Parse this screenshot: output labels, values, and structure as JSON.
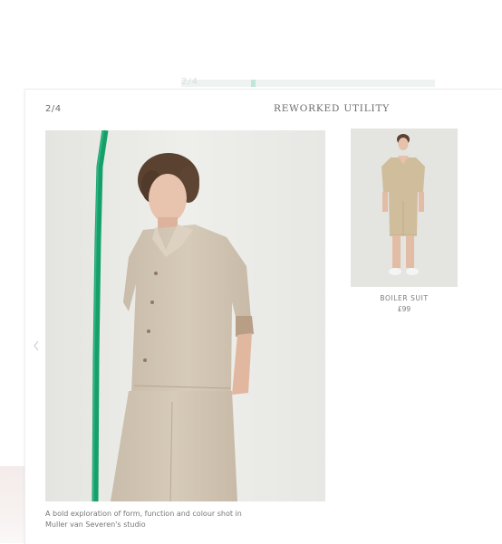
{
  "background_page": {
    "counter": "2/4"
  },
  "gallery": {
    "counter": "2/4",
    "title": "REWORKED UTILITY",
    "caption": "A bold exploration of form, function and colour shot in Muller van Severen's studio",
    "prev_icon": "chevron-left-icon"
  },
  "product": {
    "name": "BOILER SUIT",
    "price": "£99"
  },
  "colors": {
    "accent_green": "#16a46c",
    "garment_beige": "#d2c5b3",
    "text_grey": "#6b6b6b"
  }
}
